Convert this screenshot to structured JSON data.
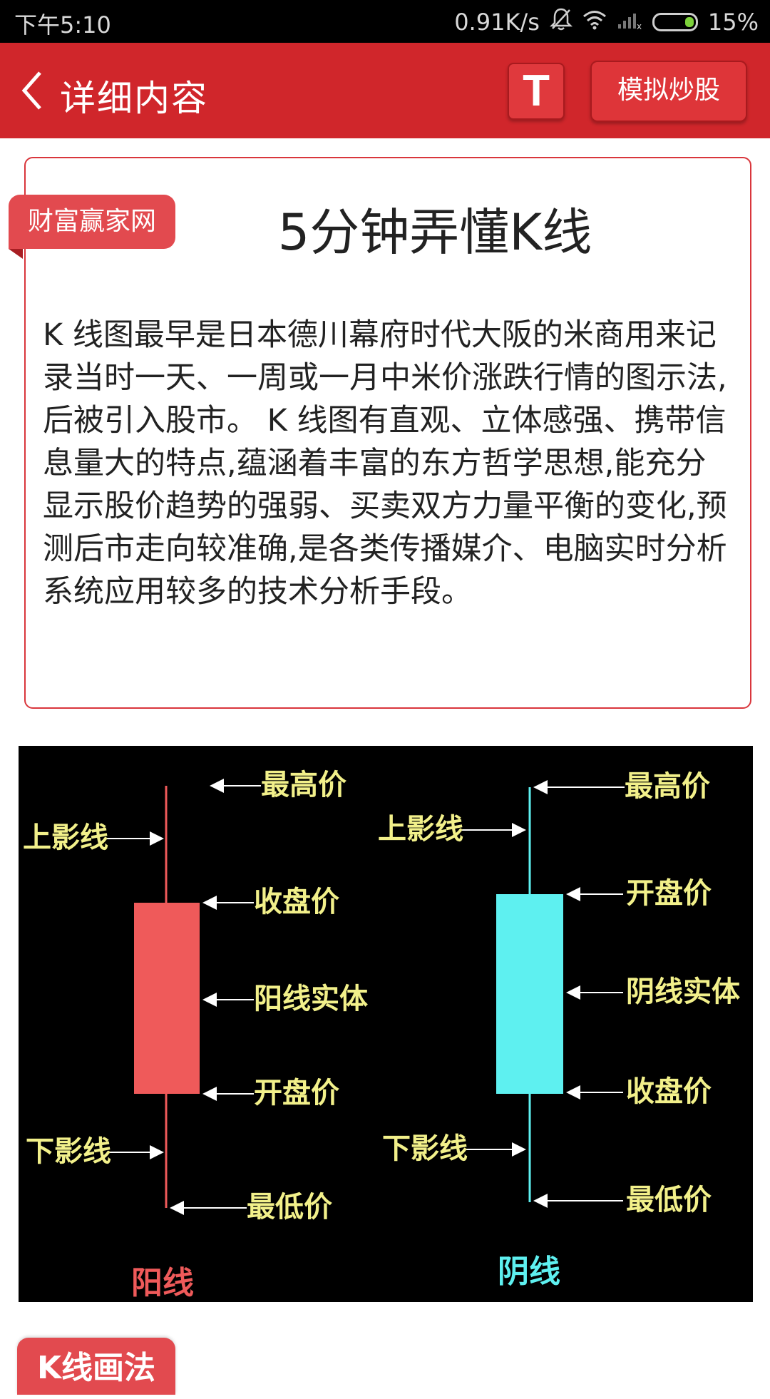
{
  "status_bar": {
    "time": "下午5:10",
    "net_speed": "0.91K/s",
    "battery_percent": "15%",
    "icons": [
      "mute-bell-icon",
      "wifi-icon",
      "signal-icon",
      "battery-icon"
    ]
  },
  "header": {
    "back_icon": "chevron-left-icon",
    "title": "详细内容",
    "t_label": "T",
    "simulate_label": "模拟炒股",
    "color": "#d0262b"
  },
  "article": {
    "source": "财富赢家网",
    "title": "5分钟弄懂K线",
    "body": " K 线图最早是日本德川幕府时代大阪的米商用来记录当时一天、一周或一月中米价涨跌行情的图示法,后被引入股市。 K 线图有直观、立体感强、携带信息量大的特点,蕴涵着丰富的东方哲学思想,能充分显示股价趋势的强弱、买卖双方力量平衡的变化,预测后市走向较准确,是各类传播媒介、电脑实时分析系统应用较多的技术分析手段。"
  },
  "figure": {
    "yang": {
      "upper_shadow": "上影线",
      "high": "最高价",
      "close": "收盘价",
      "body": "阳线实体",
      "open": "开盘价",
      "lower_shadow": "下影线",
      "low": "最低价",
      "caption": "阳线",
      "color": "#ef5a5a"
    },
    "yin": {
      "upper_shadow": "上影线",
      "high": "最高价",
      "open": "开盘价",
      "body": "阴线实体",
      "close": "收盘价",
      "lower_shadow": "下影线",
      "low": "最低价",
      "caption": "阴线",
      "color": "#5ef0f0"
    },
    "label_color": "#f2f08a"
  },
  "next_section": {
    "label": "K线画法"
  }
}
